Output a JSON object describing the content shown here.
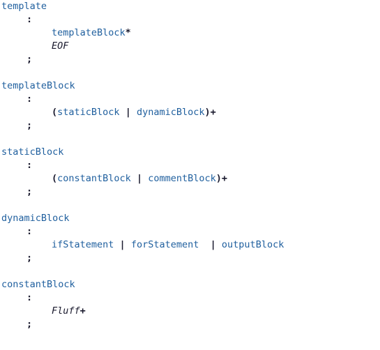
{
  "document": {
    "kind": "grammar-listing",
    "language": "ANTLR grammar",
    "background_color": "#ffffff",
    "colors": {
      "rule_name": "#1f5f9e",
      "rule_reference": "#1f5f9e",
      "punctuation": "#1a1a2e",
      "operator": "#1a1a2e",
      "token_name": "#1a1a2e"
    }
  },
  "rules": [
    {
      "name": "template",
      "colon": ":",
      "semicolon": ";",
      "body_lines": [
        {
          "parts": [
            {
              "kind": "ref",
              "text": "templateBlock"
            },
            {
              "kind": "op",
              "text": "*"
            }
          ]
        },
        {
          "parts": [
            {
              "kind": "token",
              "text": "EOF"
            }
          ]
        }
      ]
    },
    {
      "name": "templateBlock",
      "colon": ":",
      "semicolon": ";",
      "body_lines": [
        {
          "parts": [
            {
              "kind": "punct",
              "text": "("
            },
            {
              "kind": "ref",
              "text": "staticBlock"
            },
            {
              "kind": "space",
              "text": " "
            },
            {
              "kind": "op",
              "text": "|"
            },
            {
              "kind": "space",
              "text": " "
            },
            {
              "kind": "ref",
              "text": "dynamicBlock"
            },
            {
              "kind": "punct",
              "text": ")"
            },
            {
              "kind": "op",
              "text": "+"
            }
          ]
        }
      ]
    },
    {
      "name": "staticBlock",
      "colon": ":",
      "semicolon": ";",
      "body_lines": [
        {
          "parts": [
            {
              "kind": "punct",
              "text": "("
            },
            {
              "kind": "ref",
              "text": "constantBlock"
            },
            {
              "kind": "space",
              "text": " "
            },
            {
              "kind": "op",
              "text": "|"
            },
            {
              "kind": "space",
              "text": " "
            },
            {
              "kind": "ref",
              "text": "commentBlock"
            },
            {
              "kind": "punct",
              "text": ")"
            },
            {
              "kind": "op",
              "text": "+"
            }
          ]
        }
      ]
    },
    {
      "name": "dynamicBlock",
      "colon": ":",
      "semicolon": ";",
      "body_lines": [
        {
          "parts": [
            {
              "kind": "ref",
              "text": "ifStatement"
            },
            {
              "kind": "space",
              "text": " "
            },
            {
              "kind": "op",
              "text": "|"
            },
            {
              "kind": "space",
              "text": " "
            },
            {
              "kind": "ref",
              "text": "forStatement"
            },
            {
              "kind": "space",
              "text": "  "
            },
            {
              "kind": "op",
              "text": "|"
            },
            {
              "kind": "space",
              "text": " "
            },
            {
              "kind": "ref",
              "text": "outputBlock"
            }
          ]
        }
      ]
    },
    {
      "name": "constantBlock",
      "colon": ":",
      "semicolon": ";",
      "body_lines": [
        {
          "parts": [
            {
              "kind": "token",
              "text": "Fluff"
            },
            {
              "kind": "op",
              "text": "+"
            }
          ]
        }
      ]
    }
  ]
}
